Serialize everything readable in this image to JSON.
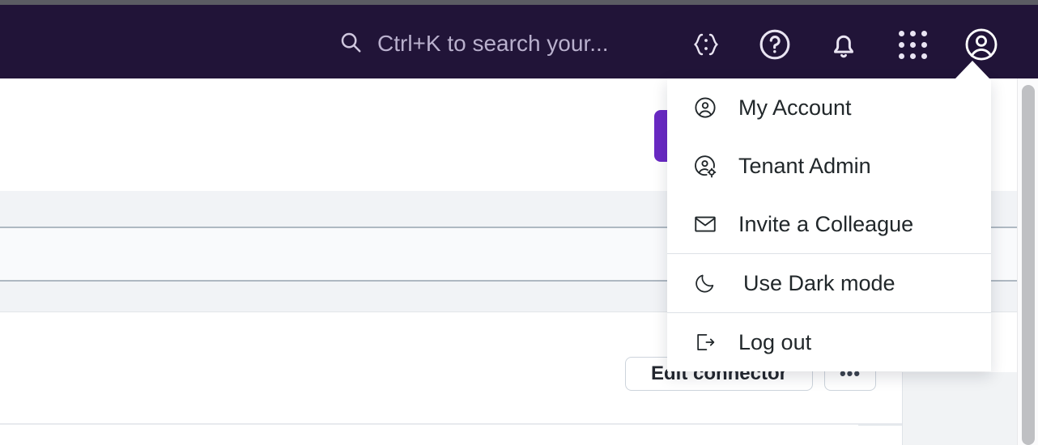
{
  "topbar": {
    "background_color": "#211438",
    "search": {
      "icon": "search-icon",
      "placeholder": "Ctrl+K to search your...",
      "value": ""
    },
    "icons": [
      {
        "name": "code-braces-icon",
        "glyph": "{:}"
      },
      {
        "name": "help-circle-icon",
        "glyph": "?"
      },
      {
        "name": "notifications-bell-icon",
        "glyph": "bell"
      },
      {
        "name": "app-switcher-grid-icon",
        "glyph": "grid-3x3"
      },
      {
        "name": "user-avatar-icon",
        "glyph": "user-circle"
      }
    ]
  },
  "account_menu": {
    "visible": true,
    "background_color": "#ffffff",
    "groups": [
      {
        "items": [
          {
            "icon": "user-circle-icon",
            "label": "My Account"
          },
          {
            "icon": "tenant-admin-icon",
            "label": "Tenant Admin"
          },
          {
            "icon": "envelope-icon",
            "label": "Invite a Colleague"
          }
        ]
      },
      {
        "items": [
          {
            "icon": "moon-icon",
            "label": "Use Dark mode"
          }
        ]
      },
      {
        "items": [
          {
            "icon": "logout-icon",
            "label": "Log out"
          }
        ]
      }
    ]
  },
  "main": {
    "primary_button": {
      "label": "",
      "color": "#6929c4"
    },
    "edit_connector_button": {
      "label": "Edit connector"
    },
    "overflow_button": {
      "label": "•••"
    }
  },
  "scrollbar": {
    "thumb_color": "#bfc0c3",
    "track_color": "#fbfbfc"
  }
}
